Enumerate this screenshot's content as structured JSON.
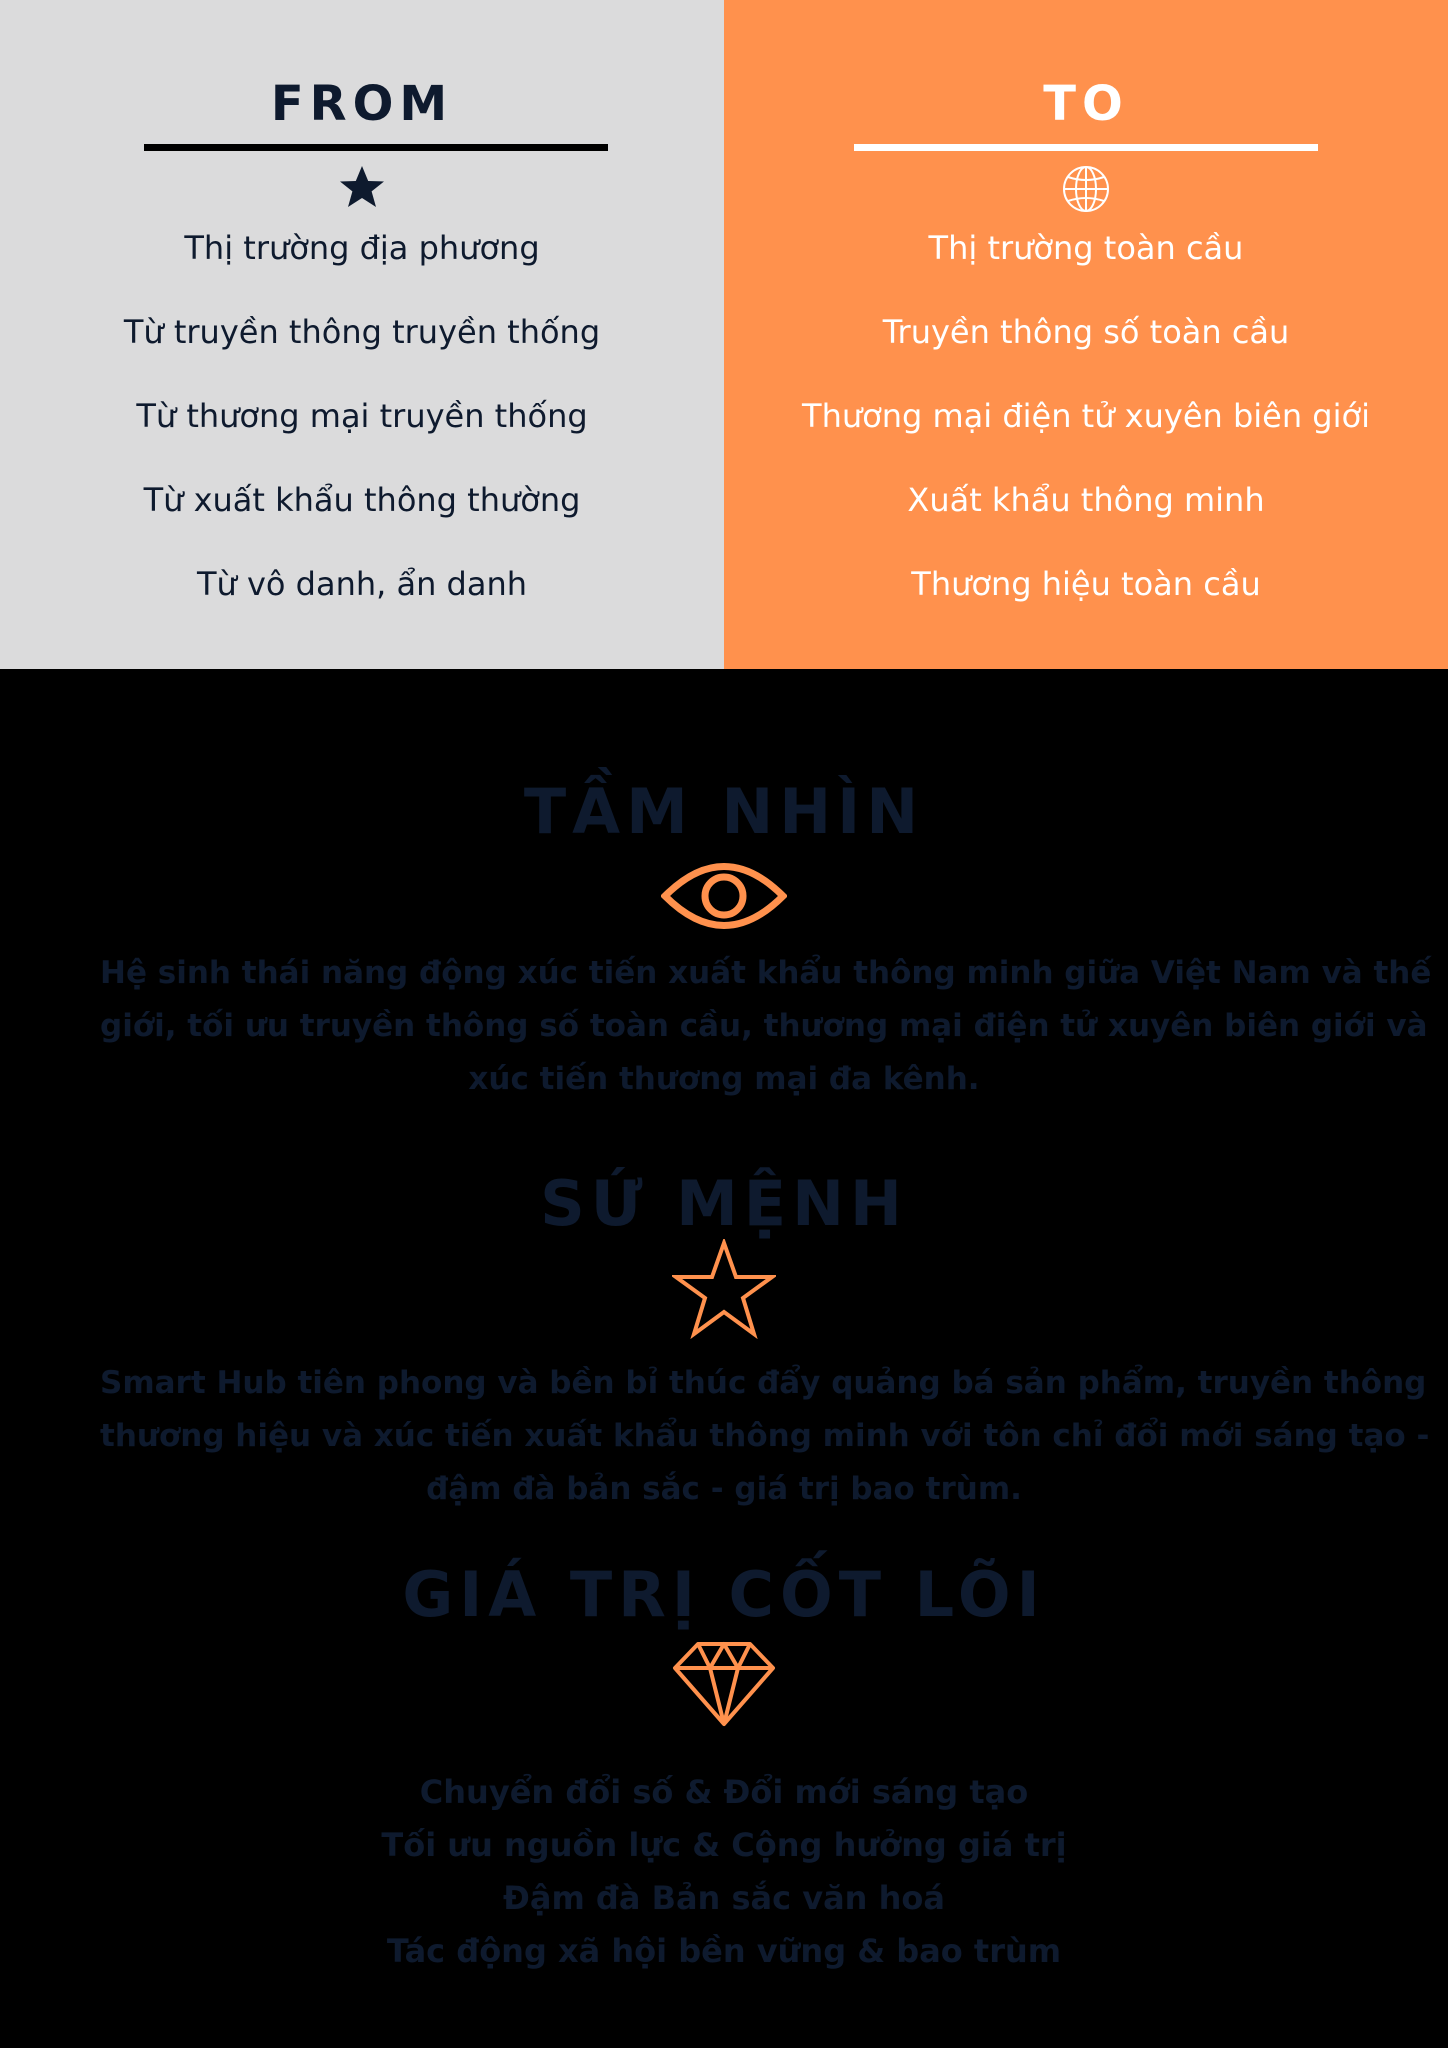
{
  "from": {
    "title": "FROM",
    "icon": "star-icon",
    "items": [
      "Thị trường địa phương",
      "Từ truyền thông truyền thống",
      "Từ thương mại truyền thống",
      "Từ xuất khẩu thông thường",
      "Từ vô danh, ẩn danh"
    ]
  },
  "to": {
    "title": "TO",
    "icon": "globe-icon",
    "items": [
      "Thị trường toàn cầu",
      "Truyền thông số toàn cầu",
      "Thương mại điện tử xuyên biên giới",
      "Xuất khẩu thông minh",
      "Thương hiệu toàn cầu"
    ]
  },
  "vision": {
    "title": "TẦM NHÌN",
    "icon": "eye-icon",
    "lines": [
      "Hệ sinh thái năng động xúc tiến xuất khẩu thông minh giữa Việt Nam và thế",
      "giới, tối ưu truyền thông số toàn cầu, thương mại điện tử xuyên biên giới và",
      "xúc tiến thương mại đa kênh."
    ]
  },
  "mission": {
    "title": "SỨ MỆNH",
    "icon": "star-outline-icon",
    "lines": [
      "Smart Hub tiên phong và bền bỉ thúc đẩy quảng bá sản phẩm, truyền thông",
      "thương hiệu và xúc tiến xuất khẩu thông minh với tôn chỉ đổi mới sáng tạo -",
      "đậm đà bản sắc - giá trị bao trùm."
    ]
  },
  "core_values": {
    "title": "GIÁ TRỊ CỐT LÕI",
    "icon": "diamond-icon",
    "items": [
      "Chuyển đổi số & Đổi mới sáng tạo",
      "Tối ưu nguồn lực & Cộng hưởng giá trị",
      "Đậm đà Bản sắc văn hoá",
      "Tác động xã hội bền vững & bao trùm"
    ]
  },
  "colors": {
    "from_bg": "#dbdbdc",
    "to_bg": "#ff914d",
    "navy": "#0e1a2e",
    "accent": "#ff914d",
    "page_bg": "#000000"
  }
}
